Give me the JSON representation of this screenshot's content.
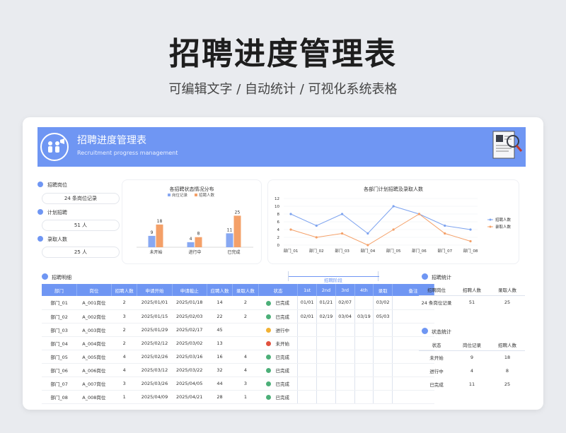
{
  "hero": {
    "title": "招聘进度管理表",
    "subtitle": "可编辑文字 / 自动统计 / 可视化系统表格"
  },
  "banner": {
    "title": "招聘进度管理表",
    "subtitle_en": "Recruitment progress management",
    "color": "#6f96f3"
  },
  "summary": [
    {
      "label": "招聘岗位",
      "value": "24 条岗位记录"
    },
    {
      "label": "计划招聘",
      "value": "51 人"
    },
    {
      "label": "录取人数",
      "value": "25 人"
    }
  ],
  "chart_data": [
    {
      "type": "bar",
      "title": "各招聘状态情况分布",
      "categories": [
        "未开始",
        "进行中",
        "已完成"
      ],
      "series": [
        {
          "name": "岗位记录",
          "values": [
            9,
            4,
            11
          ],
          "color": "#88a8f2"
        },
        {
          "name": "招聘人数",
          "values": [
            18,
            8,
            25
          ],
          "color": "#f4a068"
        }
      ],
      "ylim": [
        0,
        28
      ],
      "legend": "top"
    },
    {
      "type": "line",
      "title": "各部门计划招聘及录取人数",
      "categories": [
        "部门_01",
        "部门_02",
        "部门_03",
        "部门_04",
        "部门_05",
        "部门_06",
        "部门_07",
        "部门_08"
      ],
      "series": [
        {
          "name": "招聘人数",
          "values": [
            8,
            5,
            8,
            3,
            10,
            8,
            5,
            4
          ],
          "color": "#7da3ef"
        },
        {
          "name": "录取人数",
          "values": [
            4,
            2,
            3,
            0,
            4,
            8,
            3,
            1
          ],
          "color": "#f4a068"
        }
      ],
      "yticks": [
        0,
        2,
        4,
        6,
        8,
        10,
        12
      ],
      "ylim": [
        0,
        12
      ],
      "legend": "right"
    }
  ],
  "detail": {
    "section_title": "招聘明细",
    "stage_group_label": "招聘阶段",
    "columns": [
      "部门",
      "岗位",
      "招聘人数",
      "申请开始",
      "申请截止",
      "应聘人数",
      "录取人数",
      "状态",
      "1st",
      "2nd",
      "3rd",
      "4th",
      "录取",
      "备注"
    ],
    "rows": [
      [
        "部门_01",
        "A_001岗位",
        "2",
        "2025/01/01",
        "2025/01/18",
        "14",
        "2",
        "已完成",
        "01/01",
        "01/21",
        "02/07",
        "",
        "03/02",
        ""
      ],
      [
        "部门_02",
        "A_002岗位",
        "3",
        "2025/01/15",
        "2025/02/03",
        "22",
        "2",
        "已完成",
        "02/01",
        "02/19",
        "03/04",
        "03/19",
        "05/03",
        ""
      ],
      [
        "部门_03",
        "A_003岗位",
        "2",
        "2025/01/29",
        "2025/02/17",
        "45",
        "",
        "进行中",
        "",
        "",
        "",
        "",
        "",
        ""
      ],
      [
        "部门_04",
        "A_004岗位",
        "2",
        "2025/02/12",
        "2025/03/02",
        "13",
        "",
        "未开始",
        "",
        "",
        "",
        "",
        "",
        ""
      ],
      [
        "部门_05",
        "A_005岗位",
        "4",
        "2025/02/26",
        "2025/03/16",
        "16",
        "4",
        "已完成",
        "",
        "",
        "",
        "",
        "",
        ""
      ],
      [
        "部门_06",
        "A_006岗位",
        "4",
        "2025/03/12",
        "2025/03/22",
        "32",
        "4",
        "已完成",
        "",
        "",
        "",
        "",
        "",
        ""
      ],
      [
        "部门_07",
        "A_007岗位",
        "3",
        "2025/03/26",
        "2025/04/05",
        "44",
        "3",
        "已完成",
        "",
        "",
        "",
        "",
        "",
        ""
      ],
      [
        "部门_08",
        "A_008岗位",
        "1",
        "2025/04/09",
        "2025/04/21",
        "28",
        "1",
        "已完成",
        "",
        "",
        "",
        "",
        "",
        ""
      ]
    ],
    "status_colors": {
      "已完成": "#4caf78",
      "进行中": "#f2b233",
      "未开始": "#e2523e"
    }
  },
  "recruit_stats": {
    "title": "招聘统计",
    "columns": [
      "招聘岗位",
      "招聘人数",
      "录取人数"
    ],
    "row": [
      "24 条岗位记录",
      "51",
      "25"
    ]
  },
  "status_stats": {
    "title": "状态统计",
    "columns": [
      "状态",
      "岗位记录",
      "招聘人数"
    ],
    "rows": [
      [
        "未开始",
        "9",
        "18"
      ],
      [
        "进行中",
        "4",
        "8"
      ],
      [
        "已完成",
        "11",
        "25"
      ]
    ]
  }
}
